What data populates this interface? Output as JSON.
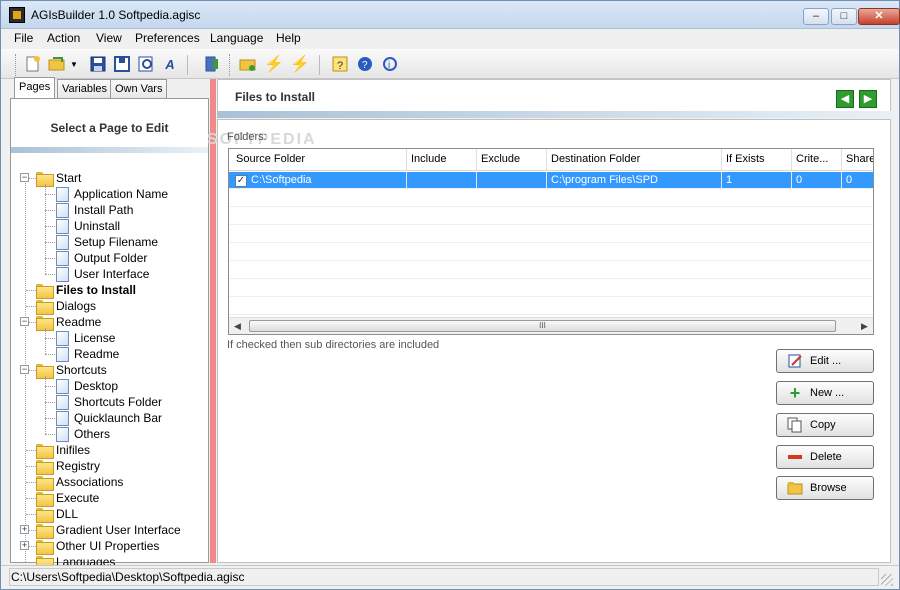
{
  "window": {
    "title": "AGIsBuilder 1.0 Softpedia.agisc",
    "minimize_icon": "minimize-icon",
    "maximize_icon": "maximize-icon",
    "close_icon": "close-icon"
  },
  "menu": [
    "File",
    "Action",
    "View",
    "Preferences",
    "Language",
    "Help"
  ],
  "toolbar_icons": [
    "new-icon",
    "open-icon",
    "dropdown-icon",
    "save-icon",
    "save-as-icon",
    "preview-icon",
    "font-icon",
    "build-icon",
    "folder-icon",
    "compile-icon",
    "run-icon",
    "help-icon",
    "about-icon",
    "info-icon"
  ],
  "left_panel": {
    "tabs": [
      "Pages",
      "Variables",
      "Own Vars"
    ],
    "title": "Select a Page to Edit",
    "tree": [
      {
        "label": "Start",
        "type": "folder",
        "level": 0,
        "expanded": true
      },
      {
        "label": "Application Name",
        "type": "page",
        "level": 1
      },
      {
        "label": "Install Path",
        "type": "page",
        "level": 1
      },
      {
        "label": "Uninstall",
        "type": "page",
        "level": 1
      },
      {
        "label": "Setup Filename",
        "type": "page",
        "level": 1
      },
      {
        "label": "Output Folder",
        "type": "page",
        "level": 1
      },
      {
        "label": "User Interface",
        "type": "page",
        "level": 1
      },
      {
        "label": "Files to Install",
        "type": "folder-open",
        "level": 0,
        "selected": true
      },
      {
        "label": "Dialogs",
        "type": "folder",
        "level": 0
      },
      {
        "label": "Readme",
        "type": "folder",
        "level": 0,
        "expanded": true
      },
      {
        "label": "License",
        "type": "page",
        "level": 1
      },
      {
        "label": "Readme",
        "type": "page",
        "level": 1
      },
      {
        "label": "Shortcuts",
        "type": "folder",
        "level": 0,
        "expanded": true
      },
      {
        "label": "Desktop",
        "type": "page",
        "level": 1
      },
      {
        "label": "Shortcuts Folder",
        "type": "page",
        "level": 1
      },
      {
        "label": "Quicklaunch Bar",
        "type": "page",
        "level": 1
      },
      {
        "label": "Others",
        "type": "page",
        "level": 1
      },
      {
        "label": "Inifiles",
        "type": "folder",
        "level": 0
      },
      {
        "label": "Registry",
        "type": "folder",
        "level": 0
      },
      {
        "label": "Associations",
        "type": "folder",
        "level": 0
      },
      {
        "label": "Execute",
        "type": "folder",
        "level": 0
      },
      {
        "label": "DLL",
        "type": "folder",
        "level": 0
      },
      {
        "label": "Gradient User Interface",
        "type": "folder",
        "level": 0,
        "collapsed": true
      },
      {
        "label": "Other UI Properties",
        "type": "folder",
        "level": 0,
        "collapsed": true
      },
      {
        "label": "Languages",
        "type": "folder",
        "level": 0
      }
    ]
  },
  "right_panel": {
    "title": "Files to Install",
    "prev_icon": "arrow-left-icon",
    "next_icon": "arrow-right-icon",
    "watermark": "SOFTPEDIA",
    "folders_label": "Folders:",
    "columns": [
      "Source Folder",
      "Include",
      "Exclude",
      "Destination Folder",
      "If Exists",
      "Crite...",
      "Share"
    ],
    "rows": [
      {
        "checked": true,
        "source": "C:\\Softpedia",
        "include": "",
        "exclude": "",
        "destination": "C:\\program Files\\SPD",
        "if_exists": "1",
        "criteria": "0",
        "share": "0"
      }
    ],
    "scroll_grip": "III",
    "hint": "If checked then sub directories are included",
    "buttons": [
      {
        "label": "Edit ...",
        "icon": "edit-icon"
      },
      {
        "label": "New ...",
        "icon": "plus-icon"
      },
      {
        "label": "Copy",
        "icon": "copy-icon"
      },
      {
        "label": "Delete",
        "icon": "minus-icon"
      },
      {
        "label": "Browse",
        "icon": "folder-icon"
      }
    ]
  },
  "status": {
    "path": "C:\\Users\\Softpedia\\Desktop\\Softpedia.agisc"
  },
  "colors": {
    "selection": "#3399ff",
    "splitter": "#f08a8a",
    "nav_button": "#2e9c2e"
  }
}
